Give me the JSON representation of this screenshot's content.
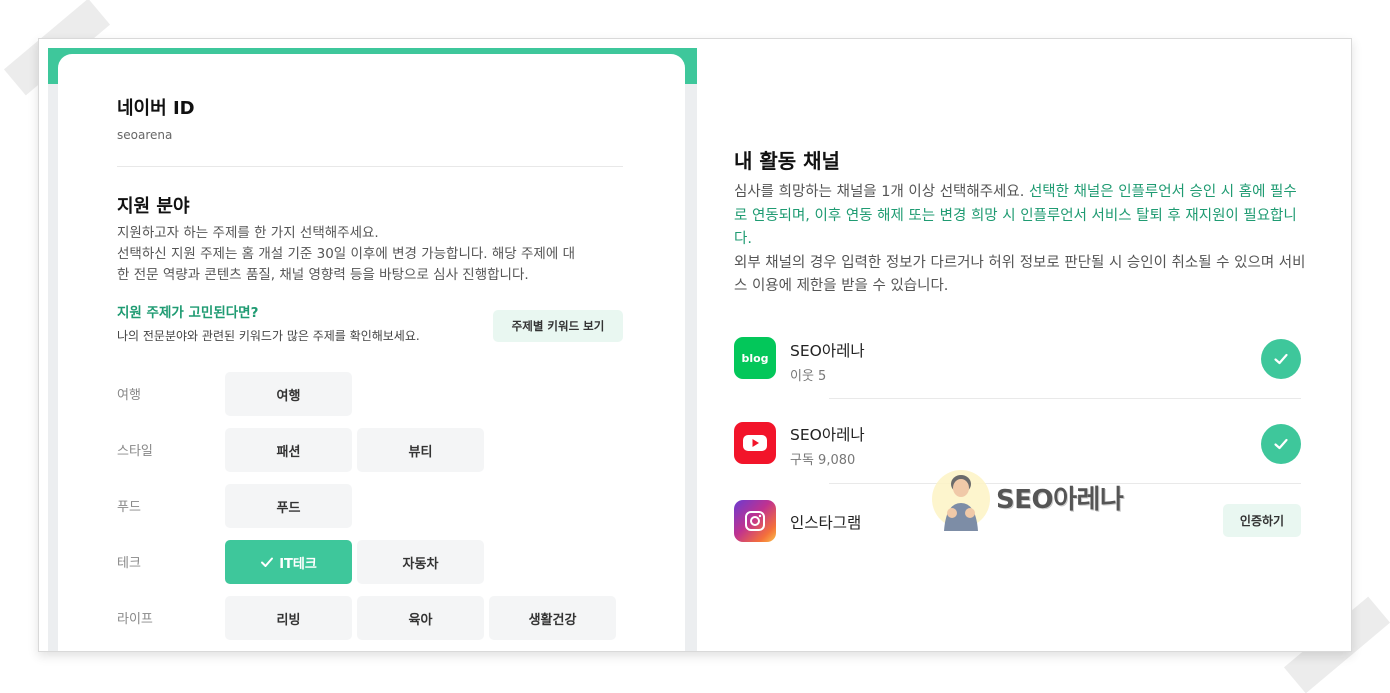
{
  "profile": {
    "naver_id_title": "네이버 ID",
    "naver_id_value": "seoarena"
  },
  "field": {
    "title": "지원 분야",
    "desc_lines": [
      "지원하고자 하는 주제를 한 가지 선택해주세요.",
      "선택하신 지원 주제는 홈 개설 기준 30일 이후에 변경 가능합니다. 해당 주제에 대",
      "한 전문 역량과 콘텐츠 품질, 채널 영향력 등을 바탕으로 심사 진행합니다."
    ],
    "hint_title": "지원 주제가 고민된다면?",
    "hint_desc": "나의 전문분야와 관련된 키워드가 많은 주제를 확인해보세요.",
    "keyword_button": "주제별 키워드 보기",
    "categories": [
      {
        "label": "여행",
        "options": [
          "여행"
        ]
      },
      {
        "label": "스타일",
        "options": [
          "패션",
          "뷰티"
        ]
      },
      {
        "label": "푸드",
        "options": [
          "푸드"
        ]
      },
      {
        "label": "테크",
        "options": [
          "IT테크",
          "자동차"
        ]
      },
      {
        "label": "라이프",
        "options": [
          "리빙",
          "육아",
          "생활건강"
        ]
      }
    ],
    "selected_option": "IT테크"
  },
  "channels": {
    "title": "내 활동 채널",
    "desc_part1": "심사를 희망하는 채널을 1개 이상 선택해주세요. ",
    "desc_highlight": "선택한 채널은 인플루언서 승인 시 홈에 필수로 연동되며, 이후 연동 해제 또는 변경 희망 시 인플루언서 서비스 탈퇴 후 재지원이 필요합니다.",
    "desc_part2": "외부 채널의 경우 입력한 정보가 다르거나 허위 정보로 판단될 시 승인이 취소될 수 있으며 서비스 이용에 제한을 받을 수 있습니다.",
    "items": [
      {
        "icon": "blog-icon",
        "icon_text": "blog",
        "name": "SEO아레나",
        "sub": "이웃 5",
        "status": "connected"
      },
      {
        "icon": "youtube-icon",
        "name": "SEO아레나",
        "sub": "구독 9,080",
        "status": "connected"
      },
      {
        "icon": "instagram-icon",
        "name": "인스타그램",
        "status": "not_connected",
        "action": "인증하기"
      }
    ]
  },
  "watermark": {
    "text": "SEO아레나"
  },
  "colors": {
    "accent": "#3ec79b",
    "accent_text": "#1f9b72",
    "blog": "#03c75a",
    "youtube": "#f2142a"
  }
}
